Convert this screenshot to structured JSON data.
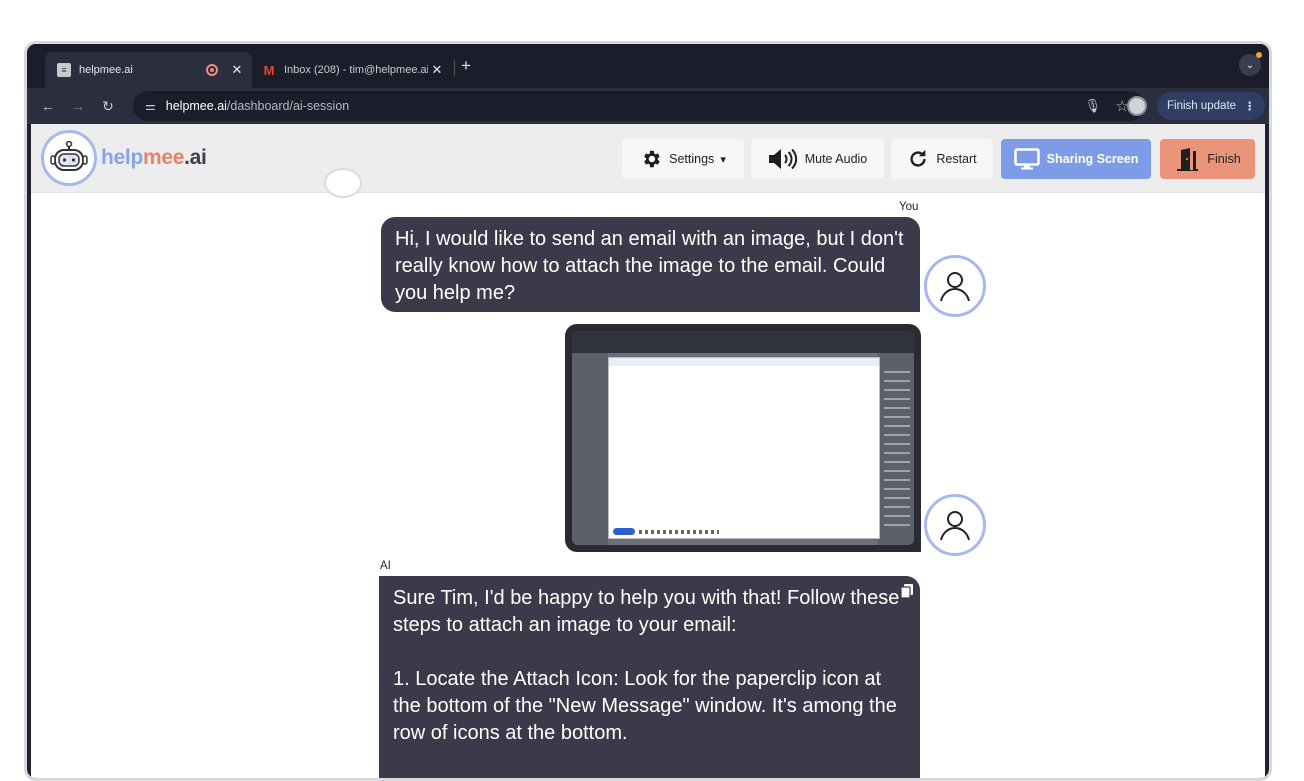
{
  "browser": {
    "tabs": [
      {
        "title": "helpmee.ai",
        "favicon": "doc-icon",
        "active": true,
        "recording": true
      },
      {
        "title": "Inbox (208) - tim@helpmee.ai",
        "favicon": "gmail-icon",
        "active": false
      }
    ],
    "url_host": "helpmee.ai",
    "url_path": "/dashboard/ai-session",
    "finish_update_label": "Finish update"
  },
  "app": {
    "logo": {
      "part1": "help",
      "part2": "mee",
      "part3": ".ai"
    },
    "buttons": {
      "settings": "Settings",
      "mute": "Mute Audio",
      "restart": "Restart",
      "sharing": "Sharing Screen",
      "finish": "Finish"
    },
    "colors": {
      "sharing_bg": "#7d9be6",
      "finish_bg": "#ea9479",
      "bubble_bg": "#3a3a4a",
      "avatar_ring": "#a9b8ec"
    }
  },
  "chat": {
    "user_label": "You",
    "user_message": "Hi, I would like to send an email with an image, but I don't really know how to attach the image to the email. Could you help me?",
    "ai_label": "AI",
    "ai_paragraph1": "Sure Tim, I'd be happy to help you with that! Follow these steps to attach an image to your email:",
    "ai_paragraph2": "1. Locate the Attach Icon: Look for the paperclip icon at the bottom of the \"New Message\" window. It's among the row of icons at the bottom."
  }
}
